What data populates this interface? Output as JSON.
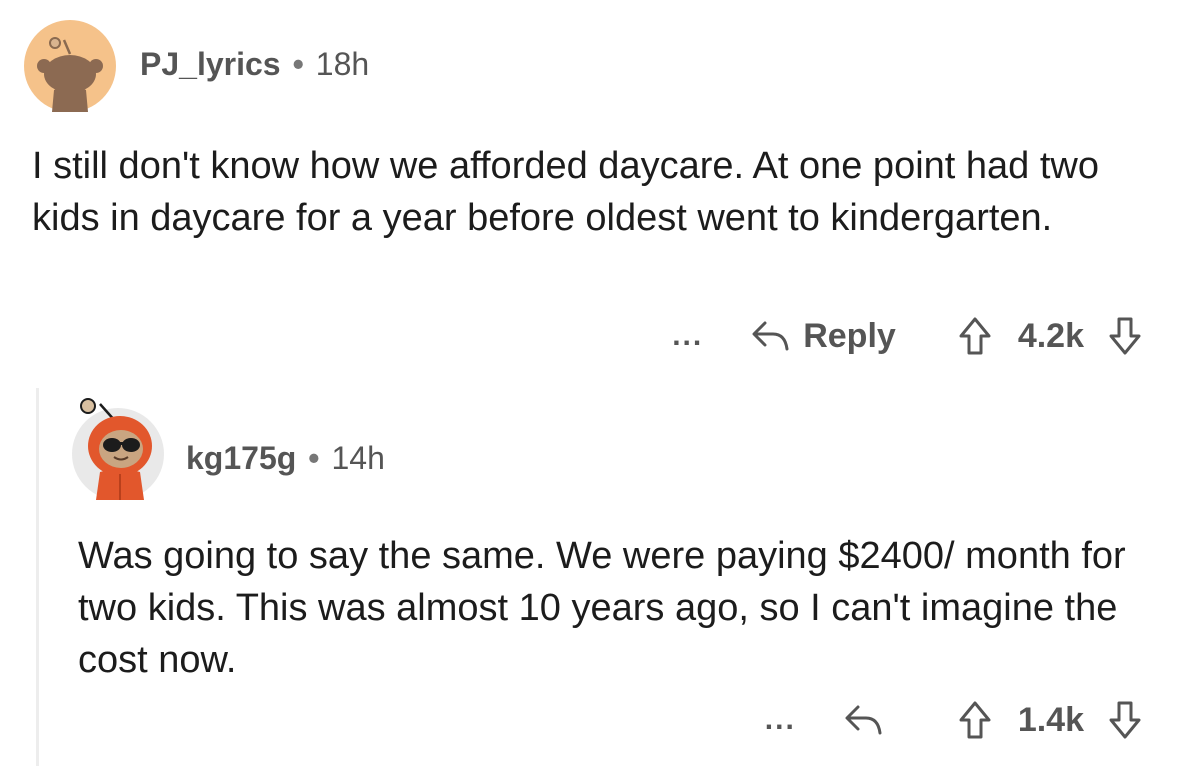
{
  "comments": [
    {
      "username": "PJ_lyrics",
      "separator": "•",
      "age": "18h",
      "body": "I still don't know how we afforded daycare. At one point had two kids in daycare for a year before oldest went to kindergarten.",
      "more": "...",
      "reply_label": "Reply",
      "score": "4.2k",
      "avatar_icon": "snoo-avatar-tan-icon"
    },
    {
      "username": "kg175g",
      "separator": "•",
      "age": "14h",
      "body": "Was going to say the same. We were paying $2400/ month for two kids. This was almost 10 years ago, so I can't imagine the cost now.",
      "more": "...",
      "reply_label": "",
      "score": "1.4k",
      "avatar_icon": "snoo-avatar-orange-hoodie-sunglasses-icon"
    }
  ],
  "icons": {
    "reply": "reply-arrow-icon",
    "upvote": "upvote-arrow-icon",
    "downvote": "downvote-arrow-icon"
  },
  "colors": {
    "text": "#1c1c1c",
    "meta": "#555555",
    "avatar_bg_top": "#f5c28a",
    "avatar_bg_reply": "#e9e9e9",
    "hoodie": "#e2572c",
    "thread_line": "#ededed"
  }
}
